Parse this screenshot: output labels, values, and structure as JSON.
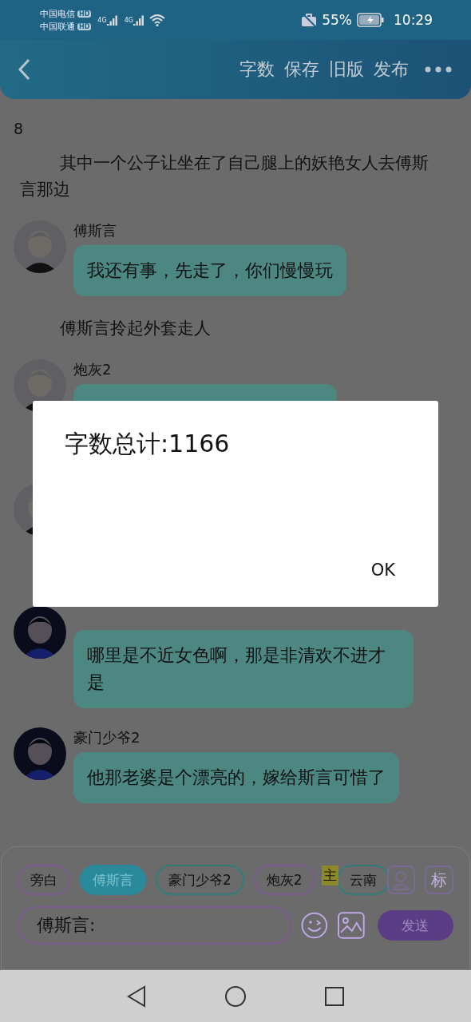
{
  "status_bar": {
    "carriers": [
      {
        "name": "中国电信",
        "badge": "HD",
        "network": "4G"
      },
      {
        "name": "中国联通",
        "badge": "HD",
        "network": "4G"
      }
    ],
    "battery": "55%",
    "time": "10:29"
  },
  "header": {
    "actions": [
      "字数",
      "保存",
      "旧版",
      "发布"
    ]
  },
  "chapter": "8",
  "story": [
    {
      "kind": "narration",
      "text": "其中一个公子让坐在了自己腿上的妖艳女人去傅斯言那边"
    },
    {
      "kind": "message",
      "name": "傅斯言",
      "text": "我还有事，先走了，你们慢慢玩"
    },
    {
      "kind": "narration",
      "text": "傅斯言拎起外套走人"
    },
    {
      "kind": "message",
      "name": "炮灰2"
    },
    {
      "kind": "message"
    },
    {
      "kind": "message",
      "text": "哪里是不近女色啊，那是非清欢不进才是"
    },
    {
      "kind": "message",
      "name": "豪门少爷2",
      "text": "他那老婆是个漂亮的，嫁给斯言可惜了"
    }
  ],
  "composer": {
    "roles": [
      {
        "label": "旁白",
        "selected": false,
        "color": "#7a5a8e"
      },
      {
        "label": "傅斯言",
        "selected": true,
        "color": "#2a8a9c"
      },
      {
        "label": "豪门少爷2",
        "selected": false,
        "color": "#2e7f7a"
      },
      {
        "label": "炮灰2",
        "selected": false,
        "color": "#7a5a8e"
      },
      {
        "label": "云南",
        "selected": false,
        "color": "#2e7f7a",
        "badge": "主"
      }
    ],
    "tag_button": "标",
    "input_value": "傅斯言:",
    "send": "发送"
  },
  "dialog": {
    "message": "字数总计:1166",
    "ok": "OK"
  }
}
